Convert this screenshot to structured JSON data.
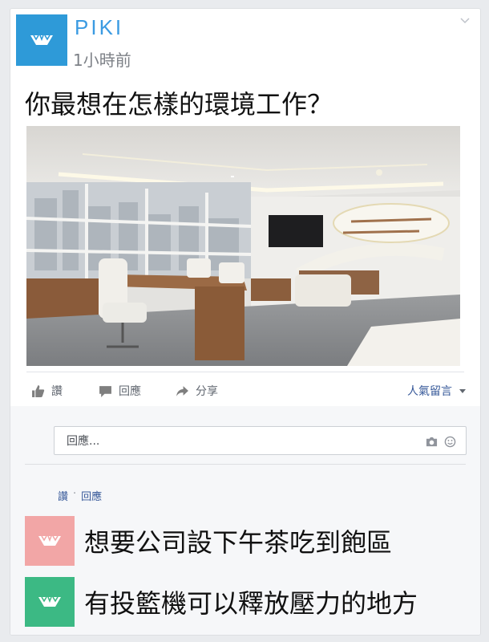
{
  "post": {
    "author": "PIKI",
    "time": "1小時前",
    "question": "你最想在怎樣的環境工作？",
    "accent_color": "#2e9ad8"
  },
  "actions": {
    "like": "讚",
    "reply": "回應",
    "share": "分享",
    "top_comments": "人氣留言"
  },
  "comment_input": {
    "placeholder": "回應..."
  },
  "comment_meta": {
    "like": "讚",
    "separator": "·",
    "reply": "回應"
  },
  "options": [
    {
      "text": "想要公司設下午茶吃到飽區",
      "color": "#f2a6a6"
    },
    {
      "text": "有投籃機可以釋放壓力的地方",
      "color": "#3cb984"
    }
  ]
}
